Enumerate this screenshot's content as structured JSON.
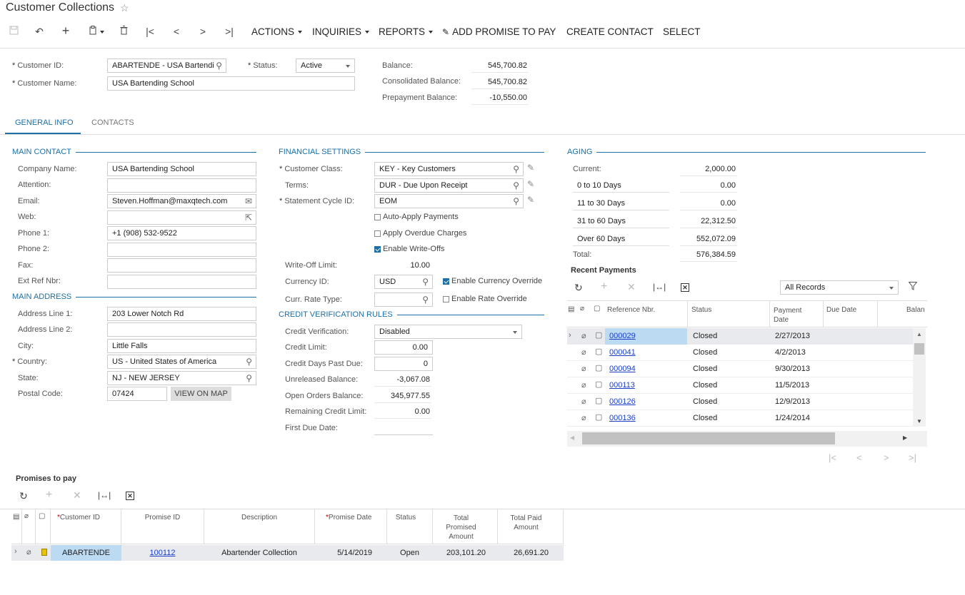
{
  "page": {
    "title": "Customer Collections",
    "star_icon": "star-icon"
  },
  "toolbar": {
    "actions_label": "ACTIONS",
    "inquiries_label": "INQUIRIES",
    "reports_label": "REPORTS",
    "add_promise_label": "ADD PROMISE TO PAY",
    "create_contact_label": "CREATE CONTACT",
    "select_label": "SELECT"
  },
  "header": {
    "customer_id_label": "Customer ID:",
    "customer_id_value": "ABARTENDE - USA Bartendi",
    "status_label": "Status:",
    "status_value": "Active",
    "customer_name_label": "Customer Name:",
    "customer_name_value": "USA Bartending School",
    "balance_label": "Balance:",
    "balance_value": "545,700.82",
    "consolidated_label": "Consolidated Balance:",
    "consolidated_value": "545,700.82",
    "prepayment_label": "Prepayment Balance:",
    "prepayment_value": "-10,550.00"
  },
  "tabs": [
    {
      "label": "GENERAL INFO"
    },
    {
      "label": "CONTACTS"
    }
  ],
  "main_contact": {
    "title": "MAIN CONTACT",
    "company_label": "Company Name:",
    "company_value": "USA Bartending School",
    "attention_label": "Attention:",
    "attention_value": "",
    "email_label": "Email:",
    "email_value": "Steven.Hoffman@maxqtech.com",
    "web_label": "Web:",
    "web_value": "",
    "phone1_label": "Phone 1:",
    "phone1_value": "+1 (908) 532-9522",
    "phone2_label": "Phone 2:",
    "phone2_value": "",
    "fax_label": "Fax:",
    "fax_value": "",
    "extref_label": "Ext Ref Nbr:",
    "extref_value": ""
  },
  "main_address": {
    "title": "MAIN ADDRESS",
    "line1_label": "Address Line 1:",
    "line1_value": "203 Lower Notch Rd",
    "line2_label": "Address Line 2:",
    "line2_value": "",
    "city_label": "City:",
    "city_value": "Little Falls",
    "country_label": "Country:",
    "country_value": "US - United States of America",
    "state_label": "State:",
    "state_value": "NJ - NEW JERSEY",
    "postal_label": "Postal Code:",
    "postal_value": "07424",
    "view_map_label": "VIEW ON MAP"
  },
  "financial": {
    "title": "FINANCIAL SETTINGS",
    "class_label": "Customer Class:",
    "class_value": "KEY - Key Customers",
    "terms_label": "Terms:",
    "terms_value": "DUR - Due Upon Receipt",
    "cycle_label": "Statement Cycle ID:",
    "cycle_value": "EOM",
    "auto_apply_label": "Auto-Apply Payments",
    "overdue_label": "Apply Overdue Charges",
    "writeoffs_label": "Enable Write-Offs",
    "writeoff_limit_label": "Write-Off Limit:",
    "writeoff_limit_value": "10.00",
    "currency_label": "Currency ID:",
    "currency_value": "USD",
    "currency_override_label": "Enable Currency Override",
    "rate_type_label": "Curr. Rate Type:",
    "rate_type_value": "",
    "rate_override_label": "Enable Rate Override"
  },
  "credit": {
    "title": "CREDIT VERIFICATION RULES",
    "verification_label": "Credit Verification:",
    "verification_value": "Disabled",
    "limit_label": "Credit Limit:",
    "limit_value": "0.00",
    "days_label": "Credit Days Past Due:",
    "days_value": "0",
    "unreleased_label": "Unreleased Balance:",
    "unreleased_value": "-3,067.08",
    "open_orders_label": "Open Orders Balance:",
    "open_orders_value": "345,977.55",
    "remaining_label": "Remaining Credit Limit:",
    "remaining_value": "0.00",
    "first_due_label": "First Due Date:",
    "first_due_value": ""
  },
  "aging": {
    "title": "AGING",
    "current_label": "Current:",
    "current_value": "2,000.00",
    "d0_10_label": "0 to 10 Days",
    "d0_10_value": "0.00",
    "d11_30_label": "11 to 30 Days",
    "d11_30_value": "0.00",
    "d31_60_label": "31 to 60 Days",
    "d31_60_value": "22,312.50",
    "over60_label": "Over 60 Days",
    "over60_value": "552,072.09",
    "total_label": "Total:",
    "total_value": "576,384.59"
  },
  "recent_payments": {
    "title": "Recent Payments",
    "filter_value": "All Records",
    "columns": {
      "ref": "Reference Nbr.",
      "status": "Status",
      "pay_date": "Payment\nDate",
      "due_date": "Due Date",
      "balance": "Balan"
    },
    "rows": [
      {
        "ref": "000029",
        "status": "Closed",
        "date": "2/27/2013"
      },
      {
        "ref": "000041",
        "status": "Closed",
        "date": "4/2/2013"
      },
      {
        "ref": "000094",
        "status": "Closed",
        "date": "9/30/2013"
      },
      {
        "ref": "000113",
        "status": "Closed",
        "date": "11/5/2013"
      },
      {
        "ref": "000126",
        "status": "Closed",
        "date": "12/9/2013"
      },
      {
        "ref": "000136",
        "status": "Closed",
        "date": "1/24/2014"
      }
    ]
  },
  "promises": {
    "title": "Promises to pay",
    "columns": {
      "customer_id": "Customer ID",
      "promise_id": "Promise ID",
      "description": "Description",
      "promise_date": "Promise Date",
      "status": "Status",
      "total_promised": "Total\nPromised\nAmount",
      "total_paid": "Total Paid\nAmount"
    },
    "rows": [
      {
        "customer_id": "ABARTENDE",
        "promise_id": "100112",
        "description": "Abartender Collection",
        "promise_date": "5/14/2019",
        "status": "Open",
        "total_promised": "203,101.20",
        "total_paid": "26,691.20"
      }
    ]
  },
  "colors": {
    "accent": "#1d6fa5",
    "link": "#1a3ec8",
    "selected_row": "#bcdaf2",
    "row_alt": "#e9eaed"
  }
}
